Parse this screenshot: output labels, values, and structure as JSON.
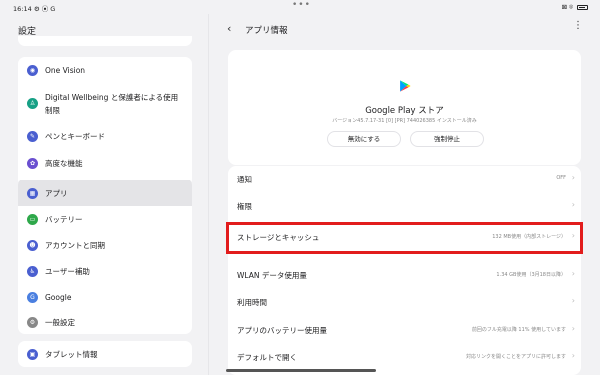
{
  "status": {
    "time": "16:14",
    "left_icons": "⚙ ⦿ G",
    "dots": "•••",
    "right_icons": "⊠ ⌾"
  },
  "sidebar": {
    "title": "設定",
    "items": [
      {
        "label": "One Vision",
        "icon": "one-vision-icon",
        "glyph": "◉",
        "color": "#4a5fd0"
      },
      {
        "label": "Digital Wellbeing と保護者による使用",
        "label2": "制限",
        "icon": "digital-wellbeing-icon",
        "glyph": "♙",
        "color": "#16a085"
      },
      {
        "label": "ペンとキーボード",
        "icon": "pen-keyboard-icon",
        "glyph": "✎",
        "color": "#4a5fd0"
      },
      {
        "label": "高度な機能",
        "icon": "advanced-features-icon",
        "glyph": "✿",
        "color": "#6a4fd0"
      },
      {
        "label": "アプリ",
        "icon": "apps-icon",
        "glyph": "▦",
        "color": "#4a5fd0"
      },
      {
        "label": "バッテリー",
        "icon": "battery-icon",
        "glyph": "▭",
        "color": "#2ea84a"
      },
      {
        "label": "アカウントと同期",
        "icon": "account-sync-icon",
        "glyph": "☻",
        "color": "#4a5fd0"
      },
      {
        "label": "ユーザー補助",
        "icon": "accessibility-icon",
        "glyph": "♿",
        "color": "#4a5fd0"
      },
      {
        "label": "Google",
        "icon": "google-icon",
        "glyph": "G",
        "color": "#4a7fe0"
      },
      {
        "label": "一般設定",
        "icon": "general-settings-icon",
        "glyph": "⚙",
        "color": "#888"
      },
      {
        "label": "タブレット情報",
        "icon": "tablet-info-icon",
        "glyph": "▣",
        "color": "#4a5fd0"
      }
    ]
  },
  "header": {
    "title": "アプリ情報",
    "back": "‹",
    "more": "⋮"
  },
  "app": {
    "name": "Google Play ストア",
    "version_info": "バージョン45.7.17-31 [0] [PR] 744026385 インストール済み",
    "disable_label": "無効にする",
    "force_stop_label": "強制停止",
    "logo_colors": [
      "#00a0ff",
      "#00e676",
      "#ff3a44",
      "#ffd500"
    ]
  },
  "settings_rows": [
    {
      "label": "通知",
      "value": "OFF"
    },
    {
      "label": "権限",
      "value": ""
    },
    {
      "label": "ストレージとキャッシュ",
      "value": "132 MB使用（内部ストレージ）"
    },
    {
      "label": "WLAN データ使用量",
      "value": "1.34 GB使用（3月18日以降）"
    },
    {
      "label": "利用時間",
      "value": ""
    },
    {
      "label": "アプリのバッテリー使用量",
      "value": "前回のフル充電以降 11% 使用しています"
    },
    {
      "label": "デフォルトで開く",
      "value": "対応リンクを開くことをアプリに許可します"
    }
  ],
  "highlight_color": "#e21c1c"
}
